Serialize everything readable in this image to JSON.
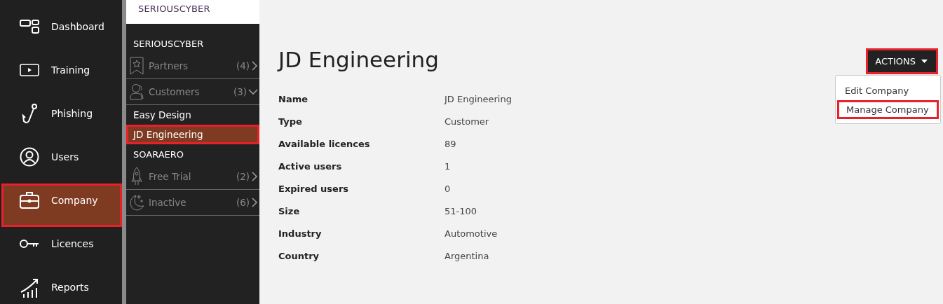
{
  "nav": [
    {
      "label": "Dashboard",
      "selected": false,
      "highlighted": false
    },
    {
      "label": "Training",
      "selected": false,
      "highlighted": false
    },
    {
      "label": "Phishing",
      "selected": false,
      "highlighted": false
    },
    {
      "label": "Users",
      "selected": false,
      "highlighted": false
    },
    {
      "label": "Company",
      "selected": true,
      "highlighted": true
    },
    {
      "label": "Licences",
      "selected": false,
      "highlighted": false
    },
    {
      "label": "Reports",
      "selected": false,
      "highlighted": false
    }
  ],
  "breadcrumb": "SERIOUSCYBER",
  "tree": [
    {
      "name": "SERIOUSCYBER",
      "categories": [
        {
          "label": "Partners",
          "kind": "partners",
          "count": "(4)",
          "expanded": false
        },
        {
          "label": "Customers",
          "kind": "customers",
          "count": "(3)",
          "expanded": true,
          "children": [
            {
              "name": "Easy Design",
              "selected": false,
              "highlighted": false
            },
            {
              "name": "JD Engineering",
              "selected": true,
              "highlighted": true
            }
          ]
        }
      ]
    },
    {
      "name": "SOARAERO",
      "categories": [
        {
          "label": "Free Trial",
          "kind": "trial",
          "count": "(2)",
          "expanded": false
        },
        {
          "label": "Inactive",
          "kind": "inactive",
          "count": "(6)",
          "expanded": false
        }
      ]
    }
  ],
  "title": "JD Engineering",
  "actions": {
    "label": "ACTIONS",
    "highlighted": true,
    "expanded": true,
    "menu": [
      {
        "label": "Edit Company",
        "highlighted": false
      },
      {
        "label": "Manage Company",
        "highlighted": true
      }
    ]
  },
  "details": [
    {
      "label": "Name",
      "value": "JD Engineering"
    },
    {
      "label": "Type",
      "value": "Customer"
    },
    {
      "label": "Available licences",
      "value": "89"
    },
    {
      "label": "Active users",
      "value": "1"
    },
    {
      "label": "Expired users",
      "value": "0"
    },
    {
      "label": "Size",
      "value": "51-100"
    },
    {
      "label": "Industry",
      "value": "Automotive"
    },
    {
      "label": "Country",
      "value": "Argentina"
    }
  ]
}
